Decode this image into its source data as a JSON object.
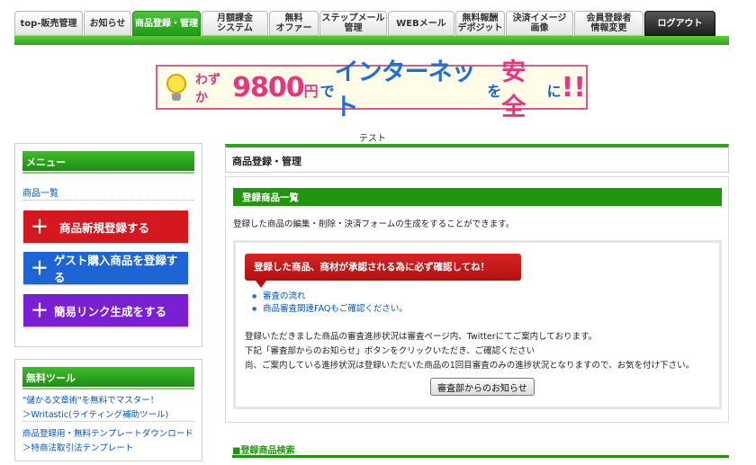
{
  "nav": {
    "tabs": [
      {
        "label": "top-販売管理",
        "state": "normal"
      },
      {
        "label": "お知らせ",
        "state": "normal"
      },
      {
        "label": "商品登録・管理",
        "state": "active"
      },
      {
        "label": "月額課金\nシステム",
        "state": "normal"
      },
      {
        "label": "無料\nオファー",
        "state": "normal"
      },
      {
        "label": "ステップメール\n管理",
        "state": "normal"
      },
      {
        "label": "WEBメール",
        "state": "normal"
      },
      {
        "label": "無料報酬\nデポジット",
        "state": "normal"
      },
      {
        "label": "決済イメージ\n画像",
        "state": "normal"
      },
      {
        "label": "会員登録者\n情報変更",
        "state": "normal"
      },
      {
        "label": "ログアウト",
        "state": "logout"
      }
    ]
  },
  "banner": {
    "pre": "わずか",
    "price": "9800",
    "yen": "円",
    "de": "で",
    "main": "インターネット",
    "wo": "を",
    "safe": "安全",
    "ni": "に",
    "excl": "!!"
  },
  "sidebar": {
    "menu_title": "メニュー",
    "menu_link": "商品一覧",
    "buttons": {
      "new_product": "商品新規登録する",
      "guest_product": "ゲスト購入商品を登録する",
      "simple_link": "簡易リンク生成をする"
    },
    "tools_title": "無料ツール",
    "tools": [
      {
        "line1": "\"儲かる文章術\"を無料でマスター！",
        "line2": "＞Writastic(ライティング補助ツール)"
      },
      {
        "line1": "商品登録用・無料テンプレートダウンロード",
        "line2": "＞特商法取引法テンプレート"
      }
    ]
  },
  "main": {
    "test_label": "テスト",
    "page_title": "商品登録・管理",
    "section_title": "登録商品一覧",
    "section_desc": "登録した商品の編集・削除・決済フォームの生成をすることができます。",
    "notice": {
      "bubble": "登録した商品、商材が承認される為に必ず確認してね！",
      "links": [
        "審査の流れ",
        "商品審査関連FAQもご確認ください。"
      ],
      "text1": "登録いただきました商品の審査進捗状況は審査ページ内、Twitterにてご案内しております。",
      "text2": "下記「審査部からのお知らせ」ボタンをクリックいただき、ご確認ください",
      "text3": "尚、ご案内している進捗状況は登録いただいた商品の1回目審査のみの進捗状況となりますので、お気を付け下さい。",
      "button": "審査部からのお知らせ"
    },
    "search_title": "■登録商品検索"
  },
  "colors": {
    "accent_green": "#22950f",
    "new_button": "#d5171f",
    "guest_button": "#1d64d5",
    "link_button": "#7a1fd5",
    "notice_red": "#c41818"
  }
}
